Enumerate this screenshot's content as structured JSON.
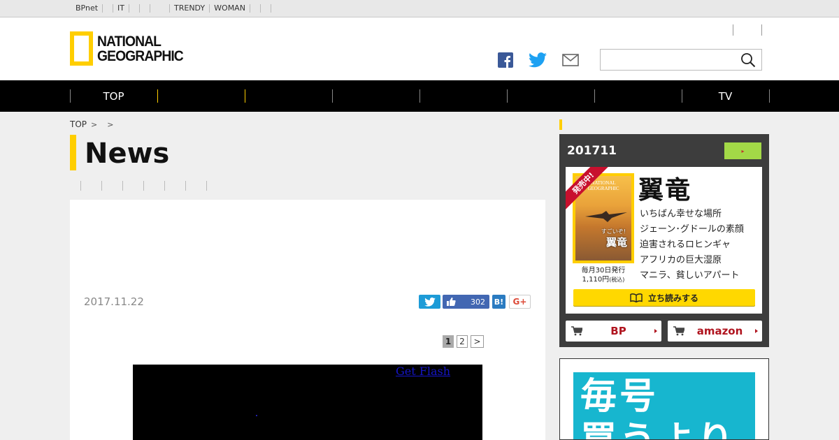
{
  "topbar": {
    "links": [
      "BPnet",
      "",
      "IT",
      "",
      "",
      "",
      "TRENDY",
      "WOMAN",
      "",
      "",
      ""
    ]
  },
  "header": {
    "logo_line1": "NATIONAL",
    "logo_line2": "GEOGRAPHIC",
    "search": {
      "value": "",
      "placeholder": ""
    },
    "social_icons": [
      "facebook-icon",
      "twitter-icon",
      "mail-icon"
    ]
  },
  "nav": {
    "items": [
      "TOP",
      "",
      "",
      "",
      "",
      "",
      "",
      "TV"
    ]
  },
  "breadcrumb": {
    "home": "TOP"
  },
  "page": {
    "title": "News"
  },
  "article": {
    "date": "2017.11.22",
    "likes": "302",
    "hatena_label": "B!",
    "gplus_label": "G+",
    "pager": {
      "pages": [
        "1",
        "2"
      ],
      "next": ">",
      "current": "1"
    },
    "video": {
      "flash_link": "Get Flash"
    }
  },
  "sidebar": {
    "magazine": {
      "issue": "201711",
      "ribbon": "発売中!",
      "cover_title_1": "NATIONAL",
      "cover_title_2": "GEOGRAPHIC",
      "cover_small": "すごいぞ!",
      "cover_big": "翼竜",
      "headline": "翼竜",
      "topics": [
        "いちばん幸せな場所",
        "ジェーン･グドールの素顔",
        "迫害されるロヒンギャ",
        "アフリカの巨大湿原",
        "マニラ、貧しいアパート"
      ],
      "frequency": "毎月30日発行",
      "price": "1,110円",
      "tax": "(税込)",
      "preview_label": "立ち読みする",
      "buy_bp": "BP",
      "buy_amazon": "amazon"
    },
    "ad": {
      "text_line1": "毎号",
      "text_line2": "買うより"
    }
  },
  "colors": {
    "accent": "#ffce00",
    "nav_bg": "#000000",
    "sidebar_bg": "#3d3d3d",
    "buy_red": "#b0141f",
    "ad_bg": "#17b6cf"
  }
}
